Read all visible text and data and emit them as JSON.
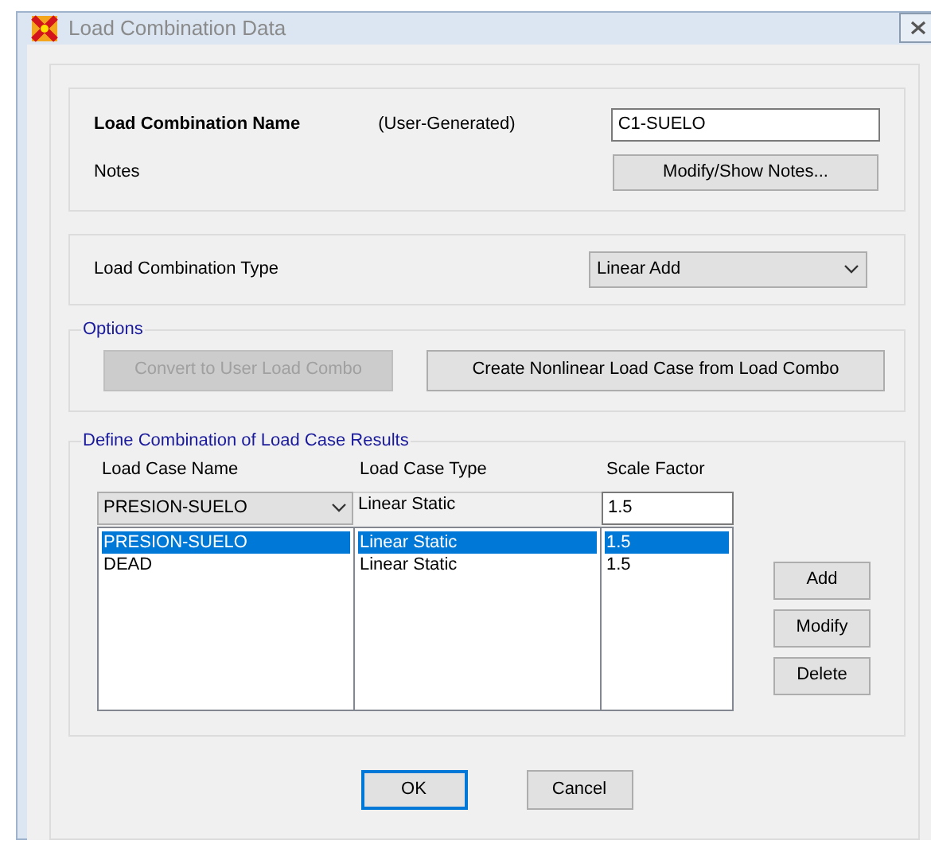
{
  "window": {
    "title": "Load Combination Data"
  },
  "name_section": {
    "label": "Load Combination Name",
    "source": "(User-Generated)",
    "value": "C1-SUELO",
    "notes_label": "Notes",
    "notes_button": "Modify/Show Notes..."
  },
  "type_section": {
    "label": "Load Combination Type",
    "value": "Linear Add"
  },
  "options": {
    "title": "Options",
    "buttons": [
      {
        "label": "Convert to User Load Combo",
        "disabled": true
      },
      {
        "label": "Create Nonlinear Load Case from Load Combo",
        "disabled": false
      }
    ]
  },
  "define": {
    "title": "Define Combination of Load Case Results",
    "columns": [
      "Load Case Name",
      "Load Case Type",
      "Scale Factor"
    ],
    "editor": {
      "case_name": "PRESION-SUELO",
      "case_type": "Linear Static",
      "scale_factor": "1.5"
    },
    "rows": [
      {
        "name": "PRESION-SUELO",
        "type": "Linear Static",
        "scale": "1.5",
        "selected": true
      },
      {
        "name": "DEAD",
        "type": "Linear Static",
        "scale": "1.5",
        "selected": false
      }
    ],
    "buttons": [
      "Add",
      "Modify",
      "Delete"
    ]
  },
  "footer": [
    {
      "label": "OK",
      "default": true
    },
    {
      "label": "Cancel",
      "default": false
    }
  ]
}
